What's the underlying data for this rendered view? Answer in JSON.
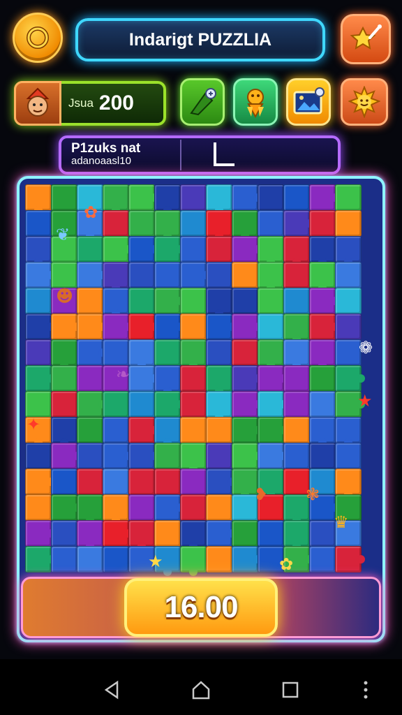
{
  "header": {
    "title": "Indarigt PUZZLIA"
  },
  "score": {
    "label": "Jsua",
    "value": "200"
  },
  "tools": [
    {
      "name": "edge-pieces-tool",
      "icon": "puzzle-edge-icon"
    },
    {
      "name": "trophy-tool",
      "icon": "trophy-icon"
    },
    {
      "name": "picture-preview-tool",
      "icon": "picture-icon"
    },
    {
      "name": "sun-tool",
      "icon": "sun-icon"
    }
  ],
  "info": {
    "line1": "P1zuks nat",
    "line2": "adanoaasl10"
  },
  "timer": {
    "value": "16.00"
  },
  "colors": {
    "accent_cyan": "#3fd8ff",
    "accent_green": "#9be22a",
    "accent_purple": "#b46bff",
    "accent_orange": "#ff9a10",
    "board_glow": "#ff5ac8"
  },
  "navbar": [
    "back-icon",
    "home-icon",
    "recents-icon",
    "more-icon"
  ]
}
